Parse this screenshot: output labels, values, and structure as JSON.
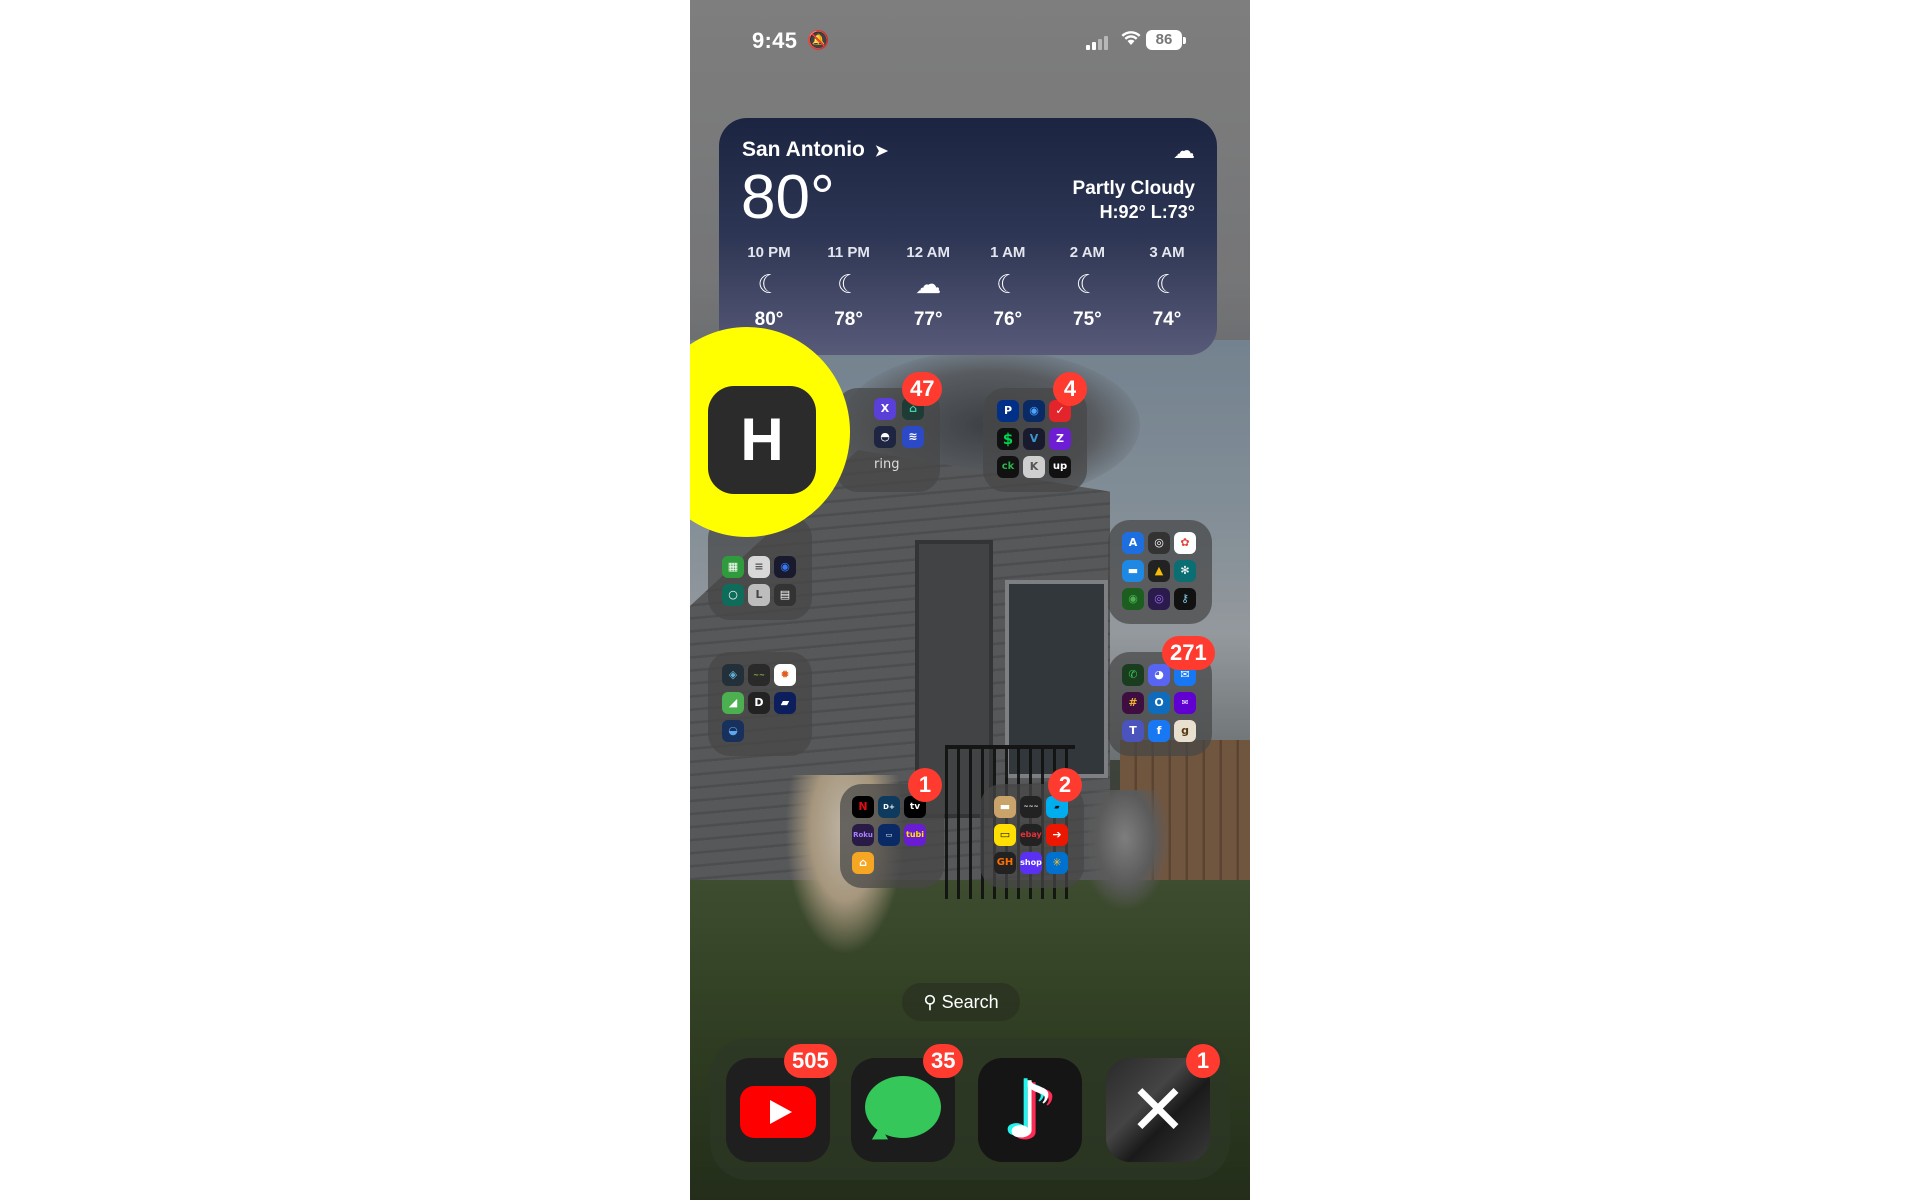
{
  "status_bar": {
    "time": "9:45",
    "battery": "86"
  },
  "weather": {
    "city": "San Antonio",
    "temp": "80°",
    "condition": "Partly Cloudy",
    "high_low": "H:92° L:73°",
    "hours": [
      {
        "time": "10 PM",
        "icon": "moon-stars",
        "temp": "80°"
      },
      {
        "time": "11 PM",
        "icon": "moon-stars",
        "temp": "78°"
      },
      {
        "time": "12 AM",
        "icon": "cloud-moon",
        "temp": "77°"
      },
      {
        "time": "1 AM",
        "icon": "moon-stars",
        "temp": "76°"
      },
      {
        "time": "2 AM",
        "icon": "moon-stars",
        "temp": "75°"
      },
      {
        "time": "3 AM",
        "icon": "moon-stars",
        "temp": "74°"
      }
    ]
  },
  "highlight_app": {
    "letter": "H",
    "color": "#ffff00"
  },
  "folders": {
    "home": {
      "badge": "47",
      "label": "ring"
    },
    "finance": {
      "badge": "4"
    },
    "streaming": {
      "badge": "1"
    },
    "shopping": {
      "badge": "2"
    },
    "communication": {
      "badge": "271"
    }
  },
  "search": {
    "label": "Search"
  },
  "dock": [
    {
      "name": "YouTube",
      "badge": "505"
    },
    {
      "name": "Messages",
      "badge": "35"
    },
    {
      "name": "TikTok",
      "badge": ""
    },
    {
      "name": "X",
      "badge": "1"
    }
  ]
}
